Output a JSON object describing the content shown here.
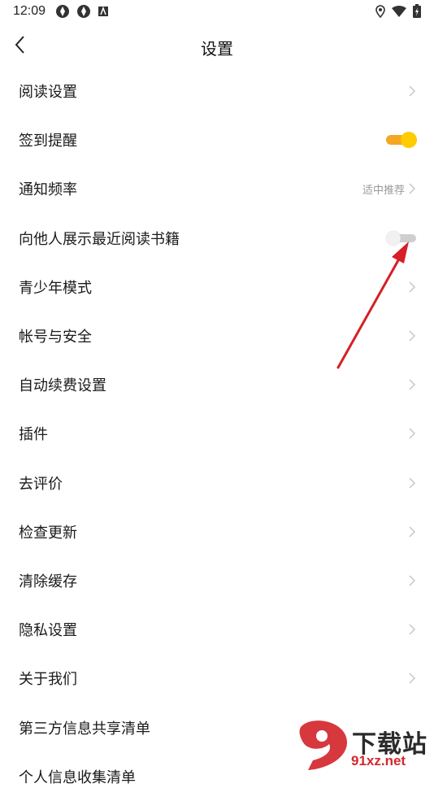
{
  "status": {
    "time": "12:09"
  },
  "header": {
    "title": "设置"
  },
  "rows": [
    {
      "label": "阅读设置"
    },
    {
      "label": "签到提醒",
      "toggle": "on"
    },
    {
      "label": "通知频率",
      "value": "适中推荐"
    },
    {
      "label": "向他人展示最近阅读书籍",
      "toggle": "off"
    },
    {
      "label": "青少年模式"
    },
    {
      "label": "帐号与安全"
    },
    {
      "label": "自动续费设置"
    },
    {
      "label": "插件"
    },
    {
      "label": "去评价"
    },
    {
      "label": "检查更新"
    },
    {
      "label": "清除缓存"
    },
    {
      "label": "隐私设置"
    },
    {
      "label": "关于我们"
    },
    {
      "label": "第三方信息共享清单"
    },
    {
      "label": "个人信息收集清单"
    }
  ],
  "watermark": {
    "title": "下载站",
    "url": "91xz.net"
  },
  "colors": {
    "accent": "#f5a623",
    "annotation_arrow": "#d61f26"
  }
}
